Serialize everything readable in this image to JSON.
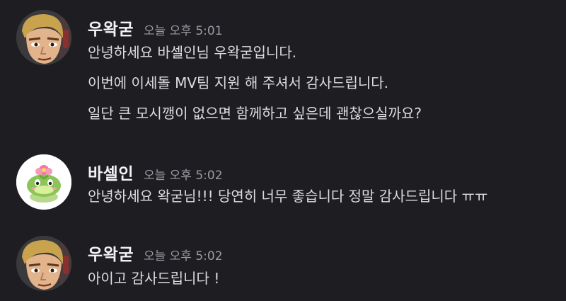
{
  "messages": [
    {
      "author": "우왁굳",
      "time": "오늘 오후 5:01",
      "lines": [
        "안녕하세요 바셀인님 우왁굳입니다.",
        "이번에 이세돌 MV팀 지원 해 주셔서 감사드립니다.",
        "일단 큰 모시깽이 없으면 함께하고 싶은데 괜찮으실까요?"
      ]
    },
    {
      "author": "바셀인",
      "time": "오늘 오후 5:02",
      "lines": [
        "안녕하세요 왁굳님!!! 당연히 너무 좋습니다 정말 감사드립니다 ㅠㅠ"
      ]
    },
    {
      "author": "우왁굳",
      "time": "오늘 오후 5:02",
      "lines": [
        "아이고 감사드립니다 !"
      ]
    }
  ],
  "colors": {
    "background": "#1e1e22",
    "username": "#f2f3f5",
    "timestamp": "#9a9ca3",
    "text": "#dcdde0"
  }
}
